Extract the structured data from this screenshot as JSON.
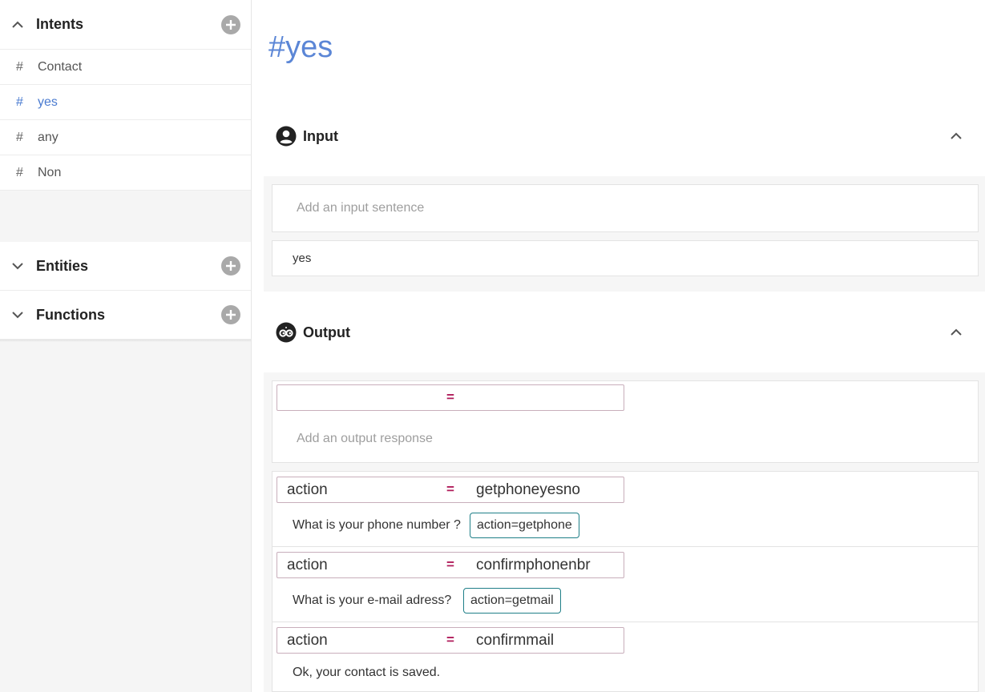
{
  "sidebar": {
    "intents": {
      "title": "Intents",
      "items": [
        {
          "hash": "#",
          "label": "Contact"
        },
        {
          "hash": "#",
          "label": "yes"
        },
        {
          "hash": "#",
          "label": "any"
        },
        {
          "hash": "#",
          "label": "Non"
        }
      ]
    },
    "entities": {
      "title": "Entities"
    },
    "functions": {
      "title": "Functions"
    }
  },
  "main": {
    "title": "#yes",
    "input": {
      "title": "Input",
      "placeholder": "Add an input sentence",
      "sentences": [
        "yes"
      ]
    },
    "output": {
      "title": "Output",
      "new_condition": {
        "key": "",
        "eq": "=",
        "value": ""
      },
      "placeholder": "Add an output response",
      "responses": [
        {
          "key": "action",
          "eq": "=",
          "value": "getphoneyesno",
          "text": "What is your phone number ?",
          "tag": "action=getphone"
        },
        {
          "key": "action",
          "eq": "=",
          "value": "confirmphonenbr",
          "text": "What is your e-mail adress?",
          "tag": "action=getmail"
        },
        {
          "key": "action",
          "eq": "=",
          "value": "confirmmail",
          "text": "Ok, your contact is saved.",
          "tag": ""
        }
      ]
    }
  },
  "colors": {
    "accent": "#5b86d6",
    "active_item": "#4a7bd0",
    "equals": "#b01b5a",
    "tag_border": "#1f7f88",
    "plus_button": "#a9a9a9"
  }
}
